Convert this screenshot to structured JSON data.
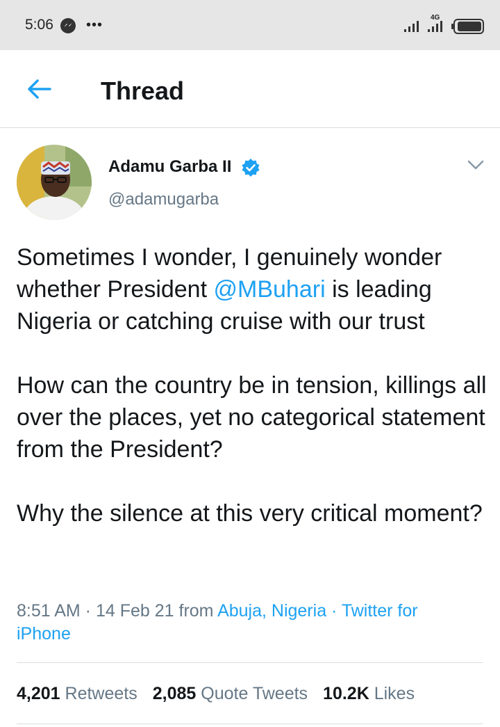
{
  "status_bar": {
    "time": "5:06",
    "more": "•••",
    "network": "4G",
    "icons": [
      "messenger-icon",
      "signal-icon",
      "battery-icon"
    ]
  },
  "header": {
    "title": "Thread",
    "back_icon": "back-arrow-icon"
  },
  "tweet": {
    "author": {
      "display_name": "Adamu Garba II",
      "handle": "@adamugarba",
      "verified": true
    },
    "paragraphs": [
      {
        "before": "Sometimes I wonder, I genuinely wonder whether President ",
        "mention": "@MBuhari",
        "after": " is leading Nigeria or catching cruise with our trust"
      },
      {
        "text": "How can the country be in tension, killings all over the places, yet no categorical statement from the President?"
      },
      {
        "text": "Why the silence at this very critical moment?"
      }
    ],
    "meta": {
      "time": "8:51 AM",
      "sep1": " · ",
      "date": "14 Feb 21",
      "from": " from ",
      "location": "Abuja, Nigeria",
      "sep2": " · ",
      "source": "Twitter for iPhone"
    },
    "stats": [
      {
        "count": "4,201",
        "label": "Retweets"
      },
      {
        "count": "2,085",
        "label": "Quote Tweets"
      },
      {
        "count": "10.2K",
        "label": "Likes"
      }
    ]
  },
  "colors": {
    "accent": "#1da1f2",
    "text": "#14171a",
    "muted": "#657786",
    "status_bar_bg": "#e6e6e6",
    "divider": "#d9dde0"
  }
}
